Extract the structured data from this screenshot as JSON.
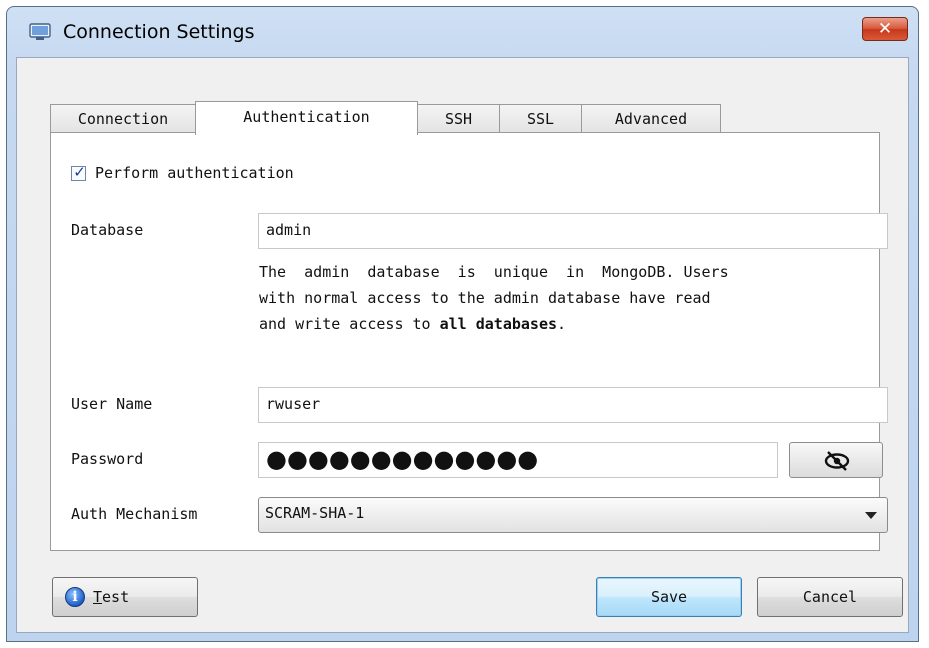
{
  "window": {
    "title": "Connection Settings",
    "close_label": "✕"
  },
  "tabs": [
    {
      "label": "Connection",
      "active": false
    },
    {
      "label": "Authentication",
      "active": true
    },
    {
      "label": "SSH",
      "active": false
    },
    {
      "label": "SSL",
      "active": false
    },
    {
      "label": "Advanced",
      "active": false
    }
  ],
  "auth": {
    "perform_label": "Perform authentication",
    "perform_checked": true,
    "database_label": "Database",
    "database_value": "admin",
    "description_line1": "The  admin  database  is  unique  in  MongoDB. Users",
    "description_line2": "with normal access to the admin database have read",
    "description_line3_prefix": "and write access to ",
    "description_line3_bold": "all databases",
    "description_line3_suffix": ".",
    "username_label": "User Name",
    "username_value": "rwuser",
    "password_label": "Password",
    "password_masked": "●●●●●●●●●●●●●",
    "mechanism_label": "Auth Mechanism",
    "mechanism_value": "SCRAM-SHA-1"
  },
  "footer": {
    "test_label_first": "T",
    "test_label_rest": "est",
    "save_label": "Save",
    "cancel_label": "Cancel"
  }
}
